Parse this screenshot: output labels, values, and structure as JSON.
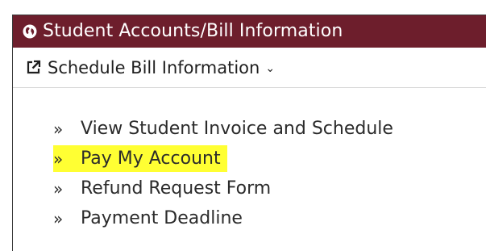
{
  "header": {
    "title": "Student Accounts/Bill Information",
    "bg_color": "#6d1e2c"
  },
  "subheader": {
    "label": "Schedule Bill Information",
    "chevron": "⌄"
  },
  "links": [
    {
      "bullet": "»",
      "label": "View Student Invoice and Schedule",
      "highlighted": false
    },
    {
      "bullet": "»",
      "label": "Pay My Account",
      "highlighted": true,
      "highlight_color": "#ffff33"
    },
    {
      "bullet": "»",
      "label": "Refund Request Form",
      "highlighted": false
    },
    {
      "bullet": "»",
      "label": "Payment Deadline",
      "highlighted": false
    }
  ],
  "icons": {
    "header_icon": "globe-icon",
    "subheader_icon": "external-link-icon"
  }
}
